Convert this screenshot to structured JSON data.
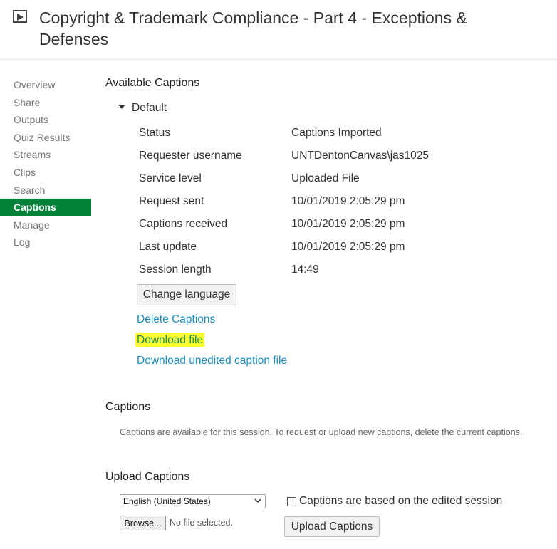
{
  "header": {
    "title": "Copyright & Trademark Compliance - Part 4 - Exceptions & Defenses"
  },
  "nav": {
    "items": [
      "Overview",
      "Share",
      "Outputs",
      "Quiz Results",
      "Streams",
      "Clips",
      "Search",
      "Captions",
      "Manage",
      "Log"
    ],
    "active": "Captions"
  },
  "available": {
    "title": "Available Captions",
    "toggle_label": "Default",
    "rows": [
      {
        "label": "Status",
        "value": "Captions Imported"
      },
      {
        "label": "Requester username",
        "value": "UNTDentonCanvas\\jas1025"
      },
      {
        "label": "Service level",
        "value": "Uploaded File"
      },
      {
        "label": "Request sent",
        "value": "10/01/2019 2:05:29 pm"
      },
      {
        "label": "Captions received",
        "value": "10/01/2019 2:05:29 pm"
      },
      {
        "label": "Last update",
        "value": "10/01/2019 2:05:29 pm"
      },
      {
        "label": "Session length",
        "value": "14:49"
      }
    ],
    "change_language_label": "Change language",
    "delete_label": "Delete Captions",
    "download_label": "Download file",
    "download_unedited_label": "Download unedited caption file"
  },
  "captions": {
    "title": "Captions",
    "info": "Captions are available for this session. To request or upload new captions, delete the current captions."
  },
  "upload": {
    "title": "Upload Captions",
    "language_selected": "English (United States)",
    "checkbox_label": "Captions are based on the edited session",
    "browse_label": "Browse...",
    "no_file_text": "No file selected.",
    "upload_button_label": "Upload Captions"
  }
}
